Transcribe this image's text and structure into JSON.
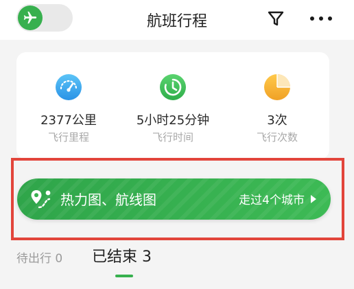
{
  "header": {
    "title": "航班行程",
    "toggle_icon": "airplane-icon",
    "filter_icon": "filter-icon",
    "more_icon": "more-dots-icon"
  },
  "stats": [
    {
      "value": "2377公里",
      "label": "飞行里程",
      "icon": "speedometer-icon",
      "color": "#34a8f0"
    },
    {
      "value": "5小时25分钟",
      "label": "飞行时间",
      "icon": "clock-icon",
      "color": "#3ec45a"
    },
    {
      "value": "3次",
      "label": "飞行次数",
      "icon": "pie-chart-icon",
      "color": "#f6b233"
    }
  ],
  "banner": {
    "label": "热力图、航线图",
    "cities": "走过4个城市",
    "icon": "map-pin-icon",
    "color": "#37b04e"
  },
  "tabs": {
    "pending": "待出行 0",
    "done": "已结束 3"
  },
  "colors": {
    "accent": "#37b04e",
    "highlight": "#e2453b"
  }
}
